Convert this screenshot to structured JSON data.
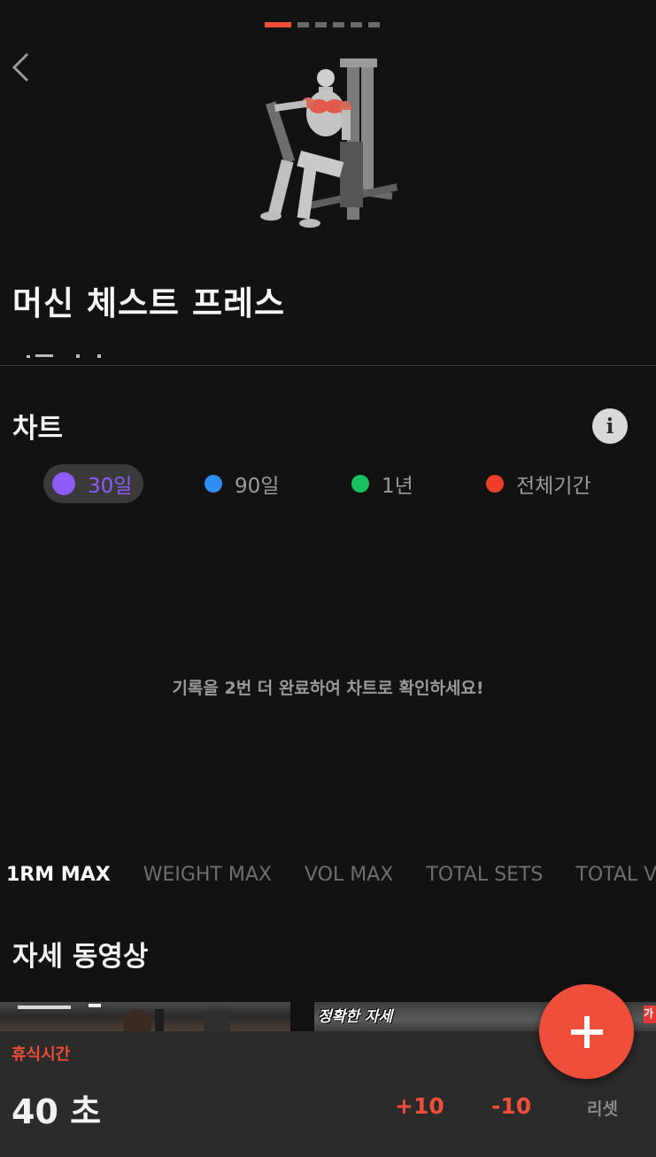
{
  "exercise": {
    "title": "머신 체스트 프레스"
  },
  "chart": {
    "heading": "차트",
    "info_icon": "i",
    "periods": [
      {
        "label": "30일",
        "color": "#8b5cf6",
        "selected": true
      },
      {
        "label": "90일",
        "color": "#2f8cf0",
        "selected": false
      },
      {
        "label": "1년",
        "color": "#19c15c",
        "selected": false
      },
      {
        "label": "전체기간",
        "color": "#ef3e2c",
        "selected": false
      }
    ],
    "empty_message": "기록을 2번 더 완료하여 차트로 확인하세요!"
  },
  "metric_tabs": [
    "1RM MAX",
    "WEIGHT MAX",
    "VOL MAX",
    "TOTAL SETS",
    "TOTAL VO"
  ],
  "videos": {
    "heading": "자세 동영상",
    "items": [
      {
        "caption": ""
      },
      {
        "caption": "정확한 자세",
        "tag": "가"
      }
    ]
  },
  "rest_timer": {
    "label": "휴식시간",
    "time": "40 초",
    "plus_label": "+10",
    "minus_label": "-10",
    "reset_label": "리셋"
  },
  "colors": {
    "accent": "#ef4e3a",
    "background": "#121212",
    "rest_bar": "#2b2b2b"
  },
  "icons": {
    "back": "chevron-left-icon",
    "info": "info-icon",
    "add": "plus-icon"
  }
}
